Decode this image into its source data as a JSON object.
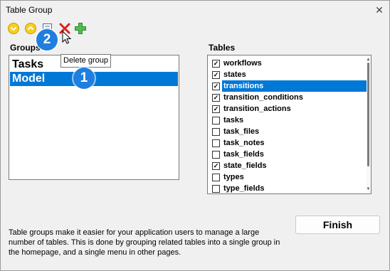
{
  "window": {
    "title": "Table Group",
    "close_glyph": "✕"
  },
  "toolbar": {
    "buttons": [
      {
        "name": "move-down-button",
        "icon": "arrow-down-circle-icon",
        "color": "#f2c200"
      },
      {
        "name": "move-up-button",
        "icon": "arrow-up-circle-icon",
        "color": "#f2c200"
      },
      {
        "name": "edit-group-button",
        "icon": "edit-icon",
        "color": "#3a6fb0"
      },
      {
        "name": "delete-group-button",
        "icon": "red-x-icon",
        "color": "#e02020"
      },
      {
        "name": "add-group-button",
        "icon": "green-plus-icon",
        "color": "#3cb043"
      }
    ]
  },
  "groups": {
    "label": "Groups",
    "items": [
      {
        "label": "Tasks",
        "selected": false
      },
      {
        "label": "Model",
        "selected": true
      }
    ]
  },
  "tables": {
    "label": "Tables",
    "items": [
      {
        "label": "workflows",
        "checked": true,
        "selected": false
      },
      {
        "label": "states",
        "checked": true,
        "selected": false
      },
      {
        "label": "transitions",
        "checked": true,
        "selected": true
      },
      {
        "label": "transition_conditions",
        "checked": true,
        "selected": false
      },
      {
        "label": "transition_actions",
        "checked": true,
        "selected": false
      },
      {
        "label": "tasks",
        "checked": false,
        "selected": false
      },
      {
        "label": "task_files",
        "checked": false,
        "selected": false
      },
      {
        "label": "task_notes",
        "checked": false,
        "selected": false
      },
      {
        "label": "task_fields",
        "checked": false,
        "selected": false
      },
      {
        "label": "state_fields",
        "checked": true,
        "selected": false
      },
      {
        "label": "types",
        "checked": false,
        "selected": false
      },
      {
        "label": "type_fields",
        "checked": false,
        "selected": false
      }
    ]
  },
  "tooltip": {
    "text": "Delete group"
  },
  "finish_label": "Finish",
  "help_text": "Table groups make it easier for your application users to manage a large number of tables. This is done by grouping related tables into a single group in the homepage, and a single menu in other pages.",
  "badges": [
    {
      "text": "1"
    },
    {
      "text": "2"
    }
  ],
  "colors": {
    "selection": "#0078d7",
    "badge": "#1f7ee0"
  }
}
